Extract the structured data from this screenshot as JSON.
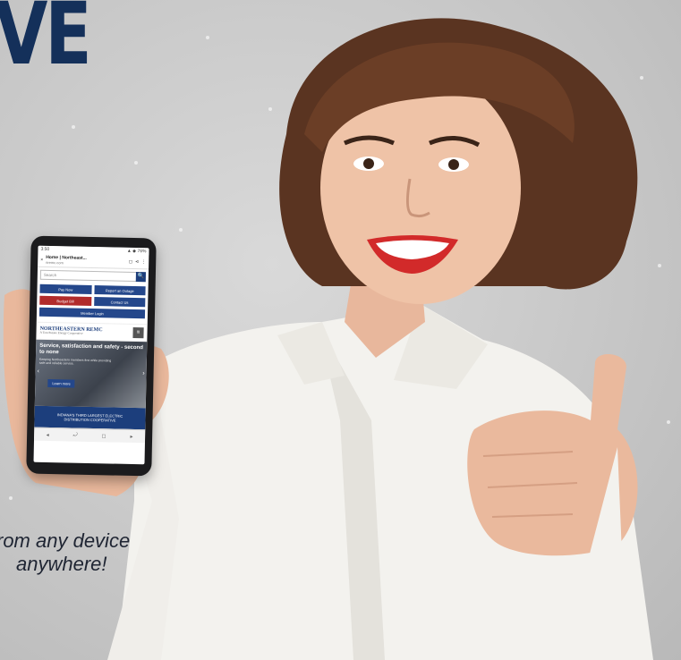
{
  "headline": "VE",
  "tagline": {
    "line1": "rom any device",
    "line2": "anywhere!"
  },
  "phone": {
    "status": {
      "time": "3:50",
      "icons": "▲ ◆ 76%"
    },
    "browser": {
      "title": "Home | Northeast...",
      "url": "nremc.com",
      "close": "×",
      "tabs": "◻",
      "share": "⋖",
      "menu": "⋮"
    },
    "search": {
      "placeholder": "Search",
      "icon": "🔍"
    },
    "quick_buttons": [
      "Pay Now",
      "Report an Outage",
      "Budget Bill",
      "Contact Us",
      "Member Login"
    ],
    "logo": {
      "name": "NORTHEASTERN REMC",
      "sub": "A Touchstone Energy Cooperative"
    },
    "hero": {
      "heading": "Service, satisfaction and safety - second to none",
      "body": "Keeping Northeastern members first while providing safe and reliable service.",
      "button": "Learn more"
    },
    "banner": {
      "line1": "INDIANA'S THIRD LARGEST ELECTRIC",
      "line2": "DISTRIBUTION COOPERATIVE"
    },
    "nav_icons": [
      "◂",
      "⤾",
      "◻",
      "▸"
    ]
  },
  "colors": {
    "brand_navy": "#14305a",
    "button_blue": "#24478b",
    "alert_red": "#b12b2b"
  }
}
